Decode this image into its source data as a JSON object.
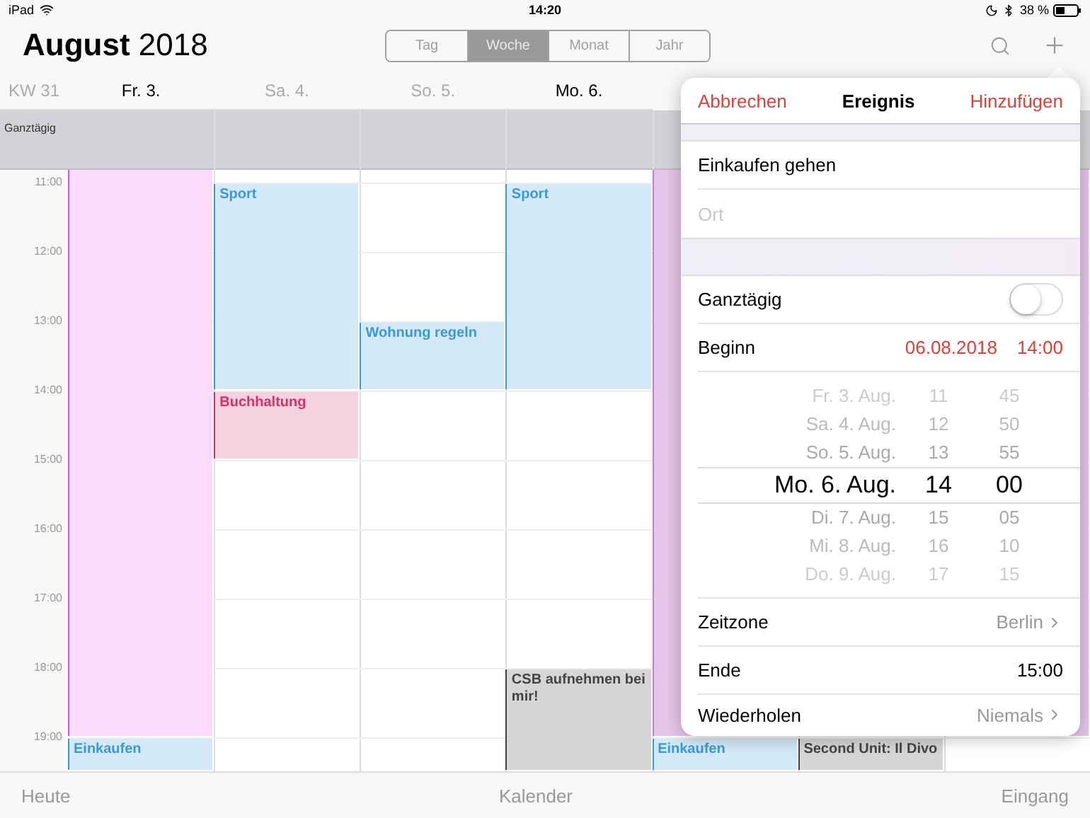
{
  "status_bar": {
    "device": "iPad",
    "time": "14:20",
    "battery": "38 %"
  },
  "header": {
    "month": "August",
    "year": "2018"
  },
  "view_tabs": [
    {
      "label": "Tag",
      "selected": false
    },
    {
      "label": "Woche",
      "selected": true
    },
    {
      "label": "Monat",
      "selected": false
    },
    {
      "label": "Jahr",
      "selected": false
    }
  ],
  "week_label": "KW 31",
  "days": [
    {
      "label": "Fr. 3.",
      "weekend": false
    },
    {
      "label": "Sa. 4.",
      "weekend": true
    },
    {
      "label": "So. 5.",
      "weekend": true
    },
    {
      "label": "Mo. 6.",
      "weekend": false
    }
  ],
  "all_day_label": "Ganztägig",
  "hours": [
    "11:00",
    "12:00",
    "13:00",
    "14:00",
    "15:00",
    "16:00",
    "17:00",
    "18:00",
    "19:00"
  ],
  "events": [
    {
      "color": "#fcdafc"
    },
    {
      "title": "Sport",
      "color": "#3a9ad9"
    },
    {
      "title": "Buchhaltung",
      "color": "#d4326a"
    },
    {
      "title": "Wohnung regeln",
      "color": "#3a9ad9"
    },
    {
      "title": "Sport",
      "color": "#3a9ad9"
    },
    {
      "title": "CSB aufnehmen bei mir!",
      "color": "#444444"
    },
    {
      "color": "#e5c5e8"
    },
    {
      "color": "#e5c5e8"
    },
    {
      "title": "Einkaufen",
      "color": "#3a9ad9"
    },
    {
      "title": "Einkaufen",
      "color": "#3a9ad9"
    },
    {
      "title": "Second Unit: Il Divo",
      "color": "#444444"
    }
  ],
  "popover": {
    "cancel": "Abbrechen",
    "title": "Ereignis",
    "add": "Hinzufügen",
    "title_field": {
      "value": "Einkaufen gehen"
    },
    "location_field": {
      "placeholder": "Ort"
    },
    "all_day": {
      "label": "Ganztägig",
      "on": false
    },
    "start": {
      "label": "Beginn",
      "date": "06.08.2018",
      "time": "14:00"
    },
    "picker": [
      {
        "date": "Fr. 3. Aug.",
        "hour": "11",
        "minute": "45",
        "selected": false
      },
      {
        "date": "Sa. 4. Aug.",
        "hour": "12",
        "minute": "50",
        "selected": false
      },
      {
        "date": "So. 5. Aug.",
        "hour": "13",
        "minute": "55",
        "selected": false
      },
      {
        "date": "Mo. 6. Aug.",
        "hour": "14",
        "minute": "00",
        "selected": true
      },
      {
        "date": "Di. 7. Aug.",
        "hour": "15",
        "minute": "05",
        "selected": false
      },
      {
        "date": "Mi. 8. Aug.",
        "hour": "16",
        "minute": "10",
        "selected": false
      },
      {
        "date": "Do. 9. Aug.",
        "hour": "17",
        "minute": "15",
        "selected": false
      }
    ],
    "timezone": {
      "label": "Zeitzone",
      "value": "Berlin"
    },
    "end": {
      "label": "Ende",
      "value": "15:00"
    },
    "repeat": {
      "label": "Wiederholen",
      "value": "Niemals"
    }
  },
  "tab_bar": [
    "Heute",
    "Kalender",
    "Eingang"
  ]
}
